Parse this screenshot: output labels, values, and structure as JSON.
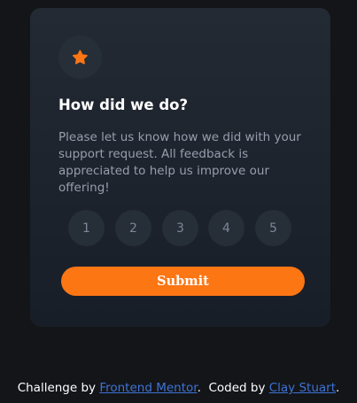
{
  "card": {
    "title": "How did we do?",
    "description": "Please let us know how we did with your support request. All feedback is appreciated to help us improve our offering!",
    "ratings": [
      "1",
      "2",
      "3",
      "4",
      "5"
    ],
    "submit_label": "Submit"
  },
  "attribution": {
    "challenge_prefix": "Challenge by ",
    "challenge_link": "Frontend Mentor",
    "middle_text": ".  Coded by ",
    "coder_link": "Clay Stuart",
    "suffix": "."
  },
  "colors": {
    "accent": "#fc7614",
    "page_background": "#131518",
    "card_background_top": "#232a34",
    "card_background_bottom": "#181e27",
    "link": "#3e73d6"
  },
  "icons": {
    "badge": "star-icon"
  }
}
